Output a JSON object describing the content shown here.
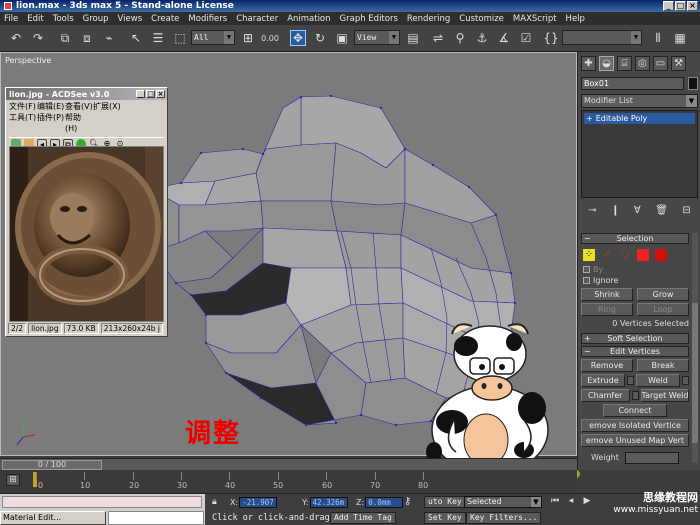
{
  "window": {
    "title": "lion.max - 3ds max 5 - Stand-alone License"
  },
  "menu": [
    "File",
    "Edit",
    "Tools",
    "Group",
    "Views",
    "Create",
    "Modifiers",
    "Character",
    "Animation",
    "Graph Editors",
    "Rendering",
    "Customize",
    "MAXScript",
    "Help"
  ],
  "toolbar": {
    "selection_filter": "All",
    "ref_coord": "View",
    "angle_value": "0.00"
  },
  "viewport": {
    "label": "Perspective"
  },
  "acdsee": {
    "title": "lion.jpg - ACDSee v3.0",
    "menu": [
      "文件(F)",
      "编辑(E)",
      "查看(V)",
      "扩展(X)",
      "工具(T)",
      "插件(P)",
      "帮助(H)"
    ],
    "status": {
      "index": "2/2",
      "file": "lion.jpg",
      "size": "73.0 KB",
      "dims": "213x260x24b j"
    }
  },
  "overlay_text": "调整",
  "command_panel": {
    "object_name": "Box01",
    "modifier_list": "Modifier List",
    "stack": [
      "Editable Poly"
    ],
    "selection": {
      "header": "Selection",
      "by_label": "By",
      "ignore_label": "Ignore",
      "shrink": "Shrink",
      "grow": "Grow",
      "ring": "Ring",
      "loop": "Loop",
      "status": "0 Vertices Selected"
    },
    "soft_selection": "Soft Selection",
    "edit_vertices": {
      "header": "Edit Vertices",
      "remove": "Remove",
      "break": "Break",
      "extrude": "Extrude",
      "weld": "Weld",
      "chamfer": "Chamfer",
      "target_weld": "Target Weld",
      "connect": "Connect",
      "remove_isolated": "emove Isolated Vertice",
      "remove_unused": "emove Unused Map Vert",
      "weight_label": "Weight"
    }
  },
  "timeline": {
    "frame": "0 / 100",
    "ticks": [
      "0",
      "10",
      "20",
      "30",
      "40",
      "50",
      "60",
      "70",
      "80"
    ]
  },
  "status": {
    "task_item": "Material Edit...",
    "x_label": "X:",
    "x": "-21.907",
    "y_label": "Y:",
    "y": "42.326m",
    "z_label": "Z:",
    "z": "0.0mm",
    "prompt": "Click or click-and-drag",
    "add_time_tag": "Add Time Tag",
    "auto_key": "uto Key",
    "set_key": "Set Key",
    "key_filters": "Key Filters...",
    "selected": "Selected"
  },
  "watermark": {
    "line1": "思缘教程网",
    "line2": "www.missyuan.net"
  }
}
